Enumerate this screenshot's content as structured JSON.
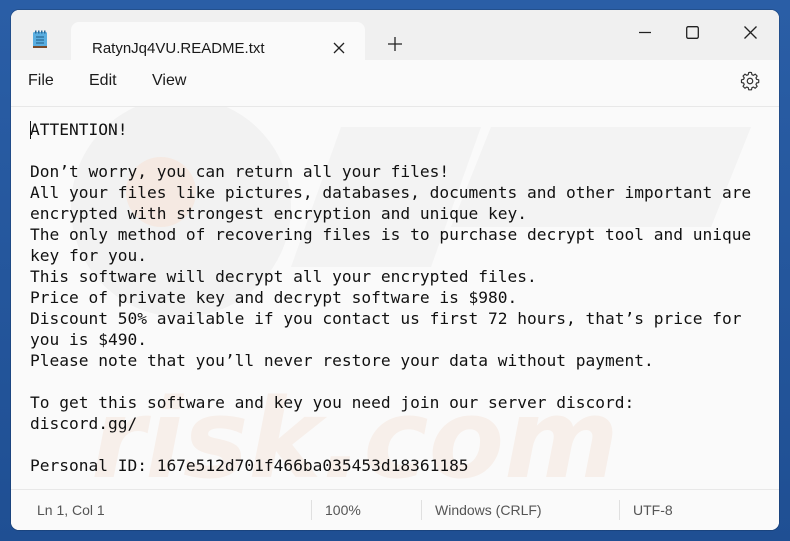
{
  "app": {
    "tab_title": "RatynJq4VU.README.txt",
    "icons": {
      "app": "notepad-icon",
      "tab_close": "close-icon",
      "new_tab": "plus-icon",
      "minimize": "minimize-icon",
      "maximize": "maximize-icon",
      "close": "close-icon",
      "settings": "gear-icon"
    }
  },
  "menu": {
    "items": [
      {
        "label": "File"
      },
      {
        "label": "Edit"
      },
      {
        "label": "View"
      }
    ]
  },
  "editor": {
    "content": "ATTENTION!\n\nDon’t worry, you can return all your files!\nAll your files like pictures, databases, documents and other important are\nencrypted with strongest encryption and unique key.\nThe only method of recovering files is to purchase decrypt tool and unique\nkey for you.\nThis software will decrypt all your encrypted files.\nPrice of private key and decrypt software is $980.\nDiscount 50% available if you contact us first 72 hours, that’s price for\nyou is $490.\nPlease note that you’ll never restore your data without payment.\n\nTo get this software and key you need join our server discord:\ndiscord.gg/\n\nPersonal ID: 167e512d701f466ba035453d18361185"
  },
  "status": {
    "position": "Ln 1, Col 1",
    "zoom": "100%",
    "line_ending": "Windows (CRLF)",
    "encoding": "UTF-8"
  },
  "colors": {
    "desktop": "#2a5ea6",
    "window_bg": "#f3f3f3",
    "editor_bg": "#fafafa",
    "text": "#111111"
  }
}
